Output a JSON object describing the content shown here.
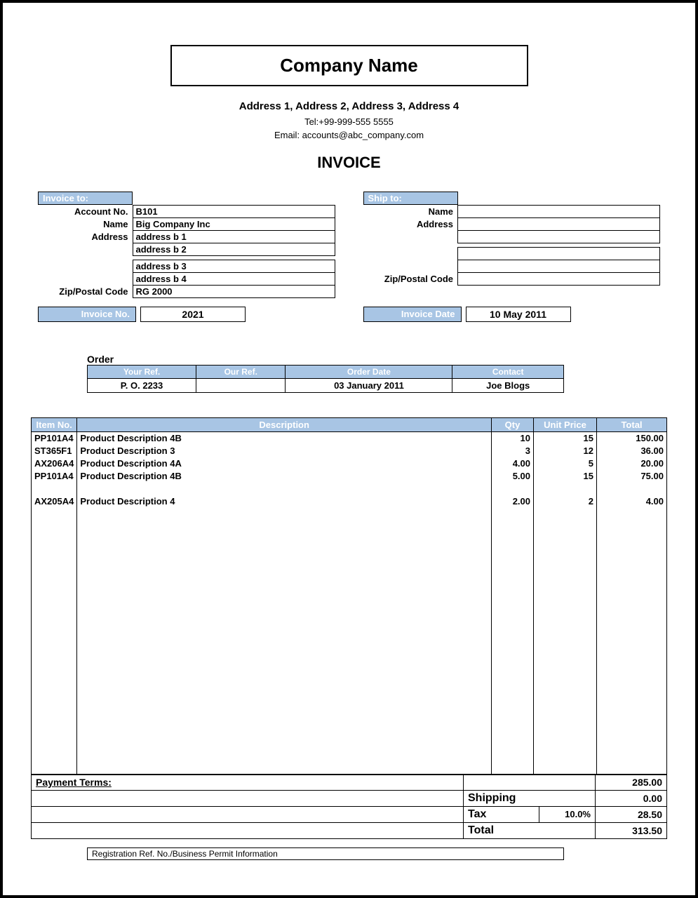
{
  "company": {
    "name": "Company Name",
    "address": "Address 1, Address 2, Address 3, Address 4",
    "tel": "Tel:+99-999-555 5555",
    "email": "Email: accounts@abc_company.com"
  },
  "title": "INVOICE",
  "invoice_to": {
    "heading": "Invoice to:",
    "labels": {
      "account": "Account No.",
      "name": "Name",
      "address": "Address",
      "zip": "Zip/Postal Code"
    },
    "account": "B101",
    "name": "Big Company Inc",
    "addr1": "address b 1",
    "addr2": "address b 2",
    "addr3": "address b 3",
    "addr4": "address b 4",
    "zip": "RG 2000"
  },
  "ship_to": {
    "heading": "Ship to:",
    "labels": {
      "name": "Name",
      "address": "Address",
      "zip": "Zip/Postal Code"
    },
    "name": "",
    "addr1": "",
    "addr2": "",
    "addr3": "",
    "addr4": "",
    "zip": ""
  },
  "meta": {
    "invoice_no_label": "Invoice No.",
    "invoice_no": "2021",
    "invoice_date_label": "Invoice Date",
    "invoice_date": "10 May 2011"
  },
  "order": {
    "title": "Order",
    "headers": {
      "your_ref": "Your Ref.",
      "our_ref": "Our Ref.",
      "order_date": "Order Date",
      "contact": "Contact"
    },
    "your_ref": "P. O. 2233",
    "our_ref": "",
    "order_date": "03 January 2011",
    "contact": "Joe Blogs"
  },
  "items": {
    "headers": {
      "item": "Item No.",
      "desc": "Description",
      "qty": "Qty",
      "price": "Unit Price",
      "total": "Total"
    },
    "rows": [
      {
        "item": "PP101A4",
        "desc": "Product Description 4B",
        "qty": "10",
        "price": "15",
        "total": "150.00"
      },
      {
        "item": "ST365F1",
        "desc": "Product Description 3",
        "qty": "3",
        "price": "12",
        "total": "36.00"
      },
      {
        "item": "AX206A4",
        "desc": "Product Description 4A",
        "qty": "4.00",
        "price": "5",
        "total": "20.00"
      },
      {
        "item": "PP101A4",
        "desc": "Product Description 4B",
        "qty": "5.00",
        "price": "15",
        "total": "75.00"
      },
      {
        "item": "",
        "desc": "",
        "qty": "",
        "price": "",
        "total": ""
      },
      {
        "item": "AX205A4",
        "desc": "Product Description 4",
        "qty": "2.00",
        "price": "2",
        "total": "4.00"
      }
    ]
  },
  "totals": {
    "payment_terms_label": "Payment Terms:",
    "subtotal": "285.00",
    "shipping_label": "Shipping",
    "shipping": "0.00",
    "tax_label": "Tax",
    "tax_rate": "10.0%",
    "tax": "28.50",
    "total_label": "Total",
    "total": "313.50"
  },
  "footer": {
    "registration": "Registration Ref. No./Business Permit Information"
  }
}
